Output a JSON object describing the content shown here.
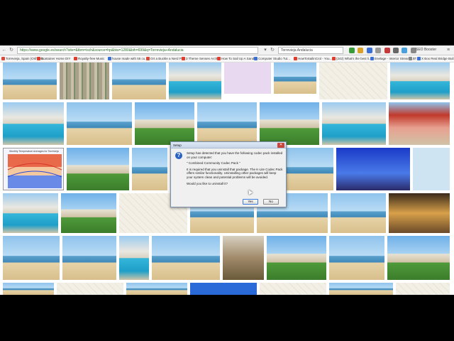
{
  "browser": {
    "url": "https://www.google.es/search?site=&tbm=isch&source=hp&biw=1280&bih=699&q=Torrevieja+Andalucia",
    "search_text": "Torrevieja Andalucia",
    "seo_label": "SEO Booster"
  },
  "bookmarks": [
    {
      "label": "Torrevieja, Spain (Orihuela...",
      "color": "#d84a3a"
    },
    {
      "label": "Container Home DIY",
      "color": "#e23c2c"
    },
    {
      "label": "Royalty-free Music",
      "color": "#e23c2c"
    },
    {
      "label": "house made with 55 cu...",
      "color": "#3a6fd8"
    },
    {
      "label": "Ort a Buckle a Nerd Fl...",
      "color": "#d84a3a"
    },
    {
      "label": "3 Theme Senses Archi...",
      "color": "#e23c2c"
    },
    {
      "label": "How To Sail Up A Sand...",
      "color": "#e23c2c"
    },
    {
      "label": "Computer Studio Tut...",
      "color": "#3a6fd8"
    },
    {
      "label": "HowToSailinCrol - You...",
      "color": "#e23c2c"
    },
    {
      "label": "(242) What's the best li...",
      "color": "#e23c2c"
    },
    {
      "label": "Enelage - Interior Stream...",
      "color": "#3a6fd8"
    },
    {
      "label": "$T...",
      "color": "#888888"
    },
    {
      "label": "X Box Real Bridge Buil...",
      "color": "#3a6fd8"
    }
  ],
  "dialog": {
    "title": "Setup",
    "icon": "question-icon",
    "message1": "Setup has detected that you have the following codec pack installed on your computer:",
    "message2": "\" Combined Community Codec Pack \"",
    "message3": "It is required that you uninstall that package. The K-Lite Codec Pack offers similar functionality. Uninstalling other packages will keep your system clean and potential problems will be avoided.",
    "message4": "Would you like to uninstall it?",
    "yes_label": "Yes",
    "no_label": "No"
  },
  "thumbnail_chart": {
    "title": "Monthly Temperature Averages for Torrevieja"
  },
  "colors": {
    "dialog_accent": "#2a62c4",
    "chart_high": "#d8342a",
    "chart_low": "#2a4ad8"
  }
}
